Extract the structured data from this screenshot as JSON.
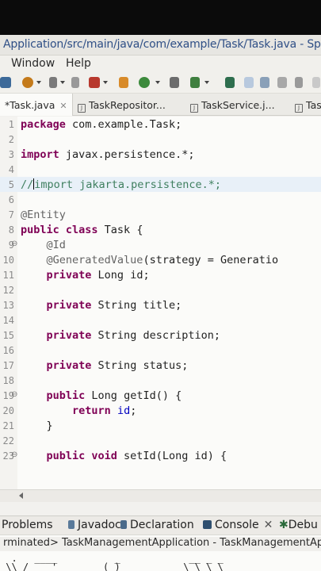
{
  "window": {
    "title": "Application/src/main/java/com/example/Task/Task.java - Spring To"
  },
  "menu": {
    "items": [
      "Window",
      "Help"
    ]
  },
  "toolbar": {
    "icons": [
      "debug-icon",
      "search-icon",
      "run-icon",
      "stop-icon",
      "package-icon",
      "run-config-icon",
      "new-icon",
      "open-type-icon",
      "next-annotation-icon",
      "pin-icon",
      "layout-icon",
      "sync-icon",
      "paragraph-icon"
    ]
  },
  "editor_tabs": [
    {
      "label": "*Task.java",
      "active": true,
      "closable": true
    },
    {
      "label": "TaskRepositor...",
      "active": false
    },
    {
      "label": "TaskService.j...",
      "active": false
    },
    {
      "label": "Tas",
      "active": false
    }
  ],
  "editor": {
    "lines": [
      {
        "num": "1",
        "text": "package com.example.Task;"
      },
      {
        "num": "2",
        "text": ""
      },
      {
        "num": "3",
        "text": "import javax.persistence.*;"
      },
      {
        "num": "4",
        "text": ""
      },
      {
        "num": "5",
        "text": "//import jakarta.persistence.*;"
      },
      {
        "num": "6",
        "text": ""
      },
      {
        "num": "7",
        "text": "@Entity"
      },
      {
        "num": "8",
        "text": "public class Task {"
      },
      {
        "num": "9",
        "text": "    @Id"
      },
      {
        "num": "10",
        "text": "    @GeneratedValue(strategy = Generatio"
      },
      {
        "num": "11",
        "text": "    private Long id;"
      },
      {
        "num": "12",
        "text": ""
      },
      {
        "num": "13",
        "text": "    private String title;"
      },
      {
        "num": "14",
        "text": ""
      },
      {
        "num": "15",
        "text": "    private String description;"
      },
      {
        "num": "16",
        "text": ""
      },
      {
        "num": "17",
        "text": "    private String status;"
      },
      {
        "num": "18",
        "text": ""
      },
      {
        "num": "19",
        "text": "    public Long getId() {"
      },
      {
        "num": "20",
        "text": "        return id;"
      },
      {
        "num": "21",
        "text": "    }"
      },
      {
        "num": "22",
        "text": ""
      },
      {
        "num": "23",
        "text": "    public void setId(Long id) {"
      }
    ]
  },
  "bottom_panel": {
    "tabs": [
      "Problems",
      "Javadoc",
      "Declaration",
      "Console",
      "Debu"
    ],
    "active_tab": "Console",
    "console_header": "rminated> TaskManagementApplication - TaskManagementApp",
    "banner": "  .   ____          _            __ _ _\n \\\\ / ___'_ __ _ _(_)_ __  __ _ \\ \\ \\ \\\n( ( )\\___ | '_ | '_| | '_ \\/ _` | \\ \\ \\ \\"
  },
  "colors": {
    "keyword": "#7f0055",
    "annotation": "#646464",
    "comment": "#3f7f5f",
    "title": "#2f4f86"
  }
}
